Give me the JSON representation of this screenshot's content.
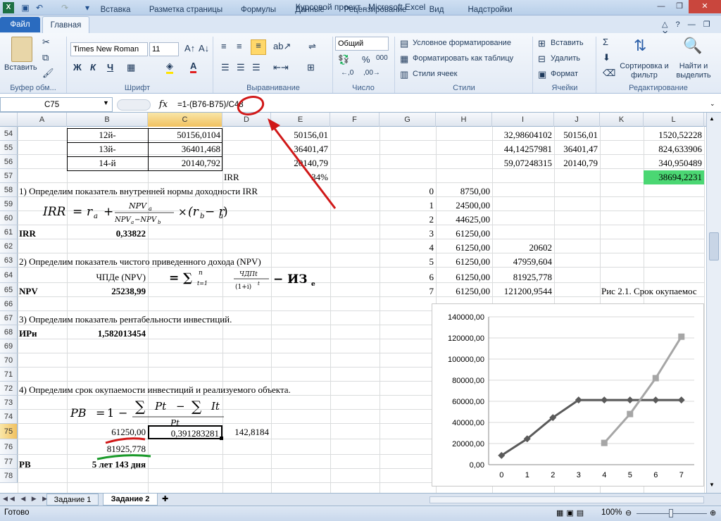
{
  "window": {
    "title": "Курсовой проект - Microsoft Excel"
  },
  "tabs": {
    "file": "Файл",
    "home": "Главная",
    "insert": "Вставка",
    "layout": "Разметка страницы",
    "formulas": "Формулы",
    "data": "Данные",
    "review": "Рецензирование",
    "view": "Вид",
    "addins": "Надстройки"
  },
  "ribbon": {
    "paste": "Вставить",
    "clipboard": "Буфер обм...",
    "font_name": "Times New Roman",
    "font_size": "11",
    "font_group": "Шрифт",
    "bold": "Ж",
    "italic": "К",
    "underline": "Ч",
    "align_group": "Выравнивание",
    "number_format": "Общий",
    "number_group": "Число",
    "percent": "%",
    "thousands": "000",
    "cond_format": "Условное форматирование",
    "format_table": "Форматировать как таблицу",
    "cell_styles": "Стили ячеек",
    "styles_group": "Стили",
    "insert": "Вставить",
    "delete": "Удалить",
    "format": "Формат",
    "cells_group": "Ячейки",
    "sort": "Сортировка и фильтр",
    "find": "Найти и выделить",
    "edit_group": "Редактирование"
  },
  "formula_bar": {
    "name_box": "C75",
    "fx": "fx",
    "formula": "=1-(B76-B75)/C48"
  },
  "columns": [
    "A",
    "B",
    "C",
    "D",
    "E",
    "F",
    "G",
    "H",
    "I",
    "J",
    "K",
    "L"
  ],
  "rows": [
    "54",
    "55",
    "56",
    "57",
    "58",
    "59",
    "60",
    "61",
    "62",
    "63",
    "64",
    "65",
    "66",
    "67",
    "68",
    "69",
    "70",
    "71",
    "72",
    "73",
    "74",
    "75",
    "76",
    "77",
    "78"
  ],
  "cells": {
    "B54": "12й-",
    "C54": "50156,0104",
    "E54": "50156,01",
    "I54": "32,98604102",
    "J54": "50156,01",
    "L54": "1520,52228",
    "B55": "13й-",
    "C55": "36401,468",
    "E55": "36401,47",
    "I55": "44,14257981",
    "J55": "36401,47",
    "L55": "824,633906",
    "B56": "14-й",
    "C56": "20140,792",
    "E56": "20140,79",
    "I56": "59,07248315",
    "J56": "20140,79",
    "L56": "340,950489",
    "D57": "IRR",
    "E57": "34%",
    "L57": "38694,2231",
    "A58": "1) Определим показатель внутренней нормы доходности IRR",
    "A61": "IRR",
    "B61": "0,33822",
    "A62": "2) Определим показатель чистого приведенного дохода (NPV)",
    "B64": "ЧПДе (NPV)",
    "A65": "NPV",
    "B65": "25238,99",
    "A67": "3) Определим показатель рентабельности инвестиций.",
    "A68": "ИРи",
    "B68": "1,582013454",
    "A72": "4) Определим срок окупаемости инвестиций и реализуемого объекта.",
    "B75": "61250,00",
    "C75": "0,391283281",
    "D75": "142,8184",
    "B76": "81925,778",
    "A77": "PB",
    "B77": "5 лет 143 дня",
    "G58": "0",
    "H58": "8750,00",
    "G59": "1",
    "H59": "24500,00",
    "G60": "2",
    "H60": "44625,00",
    "G61": "3",
    "H61": "61250,00",
    "G62": "4",
    "H62": "61250,00",
    "I62": "20602",
    "G63": "5",
    "H63": "61250,00",
    "I63": "47959,604",
    "G64": "6",
    "H64": "61250,00",
    "I64": "81925,778",
    "G65": "7",
    "H65": "61250,00",
    "I65": "121200,9544",
    "K65": "Рис 2.1. Срок окупаемос"
  },
  "formulas": {
    "irr_lhs": "IRR",
    "irr_eq": "=",
    "irr_r": "r",
    "irr_a": "a",
    "irr_plus": "+",
    "irr_num": "NPV",
    "irr_num_sub": "a",
    "irr_den": "NPV",
    "irr_den_a": "a",
    "irr_den_minus": "−NPV",
    "irr_den_b": "b",
    "irr_times": "×",
    "irr_paren": "(r",
    "irr_b": "b",
    "irr_minus": "− r",
    "irr_a2": "a",
    "irr_close": ")",
    "npv_eq": "= ∑",
    "npv_sup": "n",
    "npv_sub": "t=1",
    "npv_num": "ЧДПt",
    "npv_den": "(1+i)",
    "npv_den_sup": "t",
    "npv_tail": "− ИЗ",
    "npv_tail_sub": "е",
    "pb_lhs": "PB",
    "pb_eq": "=",
    "pb_one": "1",
    "pb_minus": "−",
    "pb_sum1": "∑",
    "pb_pt": "Pt",
    "pb_minus2": "−",
    "pb_sum2": "∑",
    "pb_it": "It",
    "pb_den": "Pt"
  },
  "sheets": {
    "tab1": "Задание 1",
    "tab2": "Задание 2"
  },
  "status": {
    "ready": "Готово",
    "zoom": "100%"
  },
  "colors": {
    "highlight": "#4bd773",
    "annotation_red": "#d01818",
    "annotation_green": "#1a9a2a",
    "series_dark": "#5a5a5a",
    "series_light": "#a6a6a6"
  },
  "chart_data": {
    "type": "line",
    "x": [
      0,
      1,
      2,
      3,
      4,
      5,
      6,
      7
    ],
    "categories": [
      "0",
      "1",
      "2",
      "3",
      "4",
      "5",
      "6",
      "7"
    ],
    "yticks": [
      "0,00",
      "20000,00",
      "40000,00",
      "60000,00",
      "80000,00",
      "100000,00",
      "120000,00",
      "140000,00"
    ],
    "ylim": [
      0,
      140000
    ],
    "series": [
      {
        "values": [
          8750,
          24500,
          44625,
          61250,
          61250,
          61250,
          61250,
          61250
        ],
        "color": "#5a5a5a",
        "marker": "diamond"
      },
      {
        "values": [
          null,
          null,
          null,
          null,
          20602,
          47959.604,
          81925.778,
          121200.9544
        ],
        "color": "#a6a6a6",
        "marker": "square"
      }
    ]
  }
}
